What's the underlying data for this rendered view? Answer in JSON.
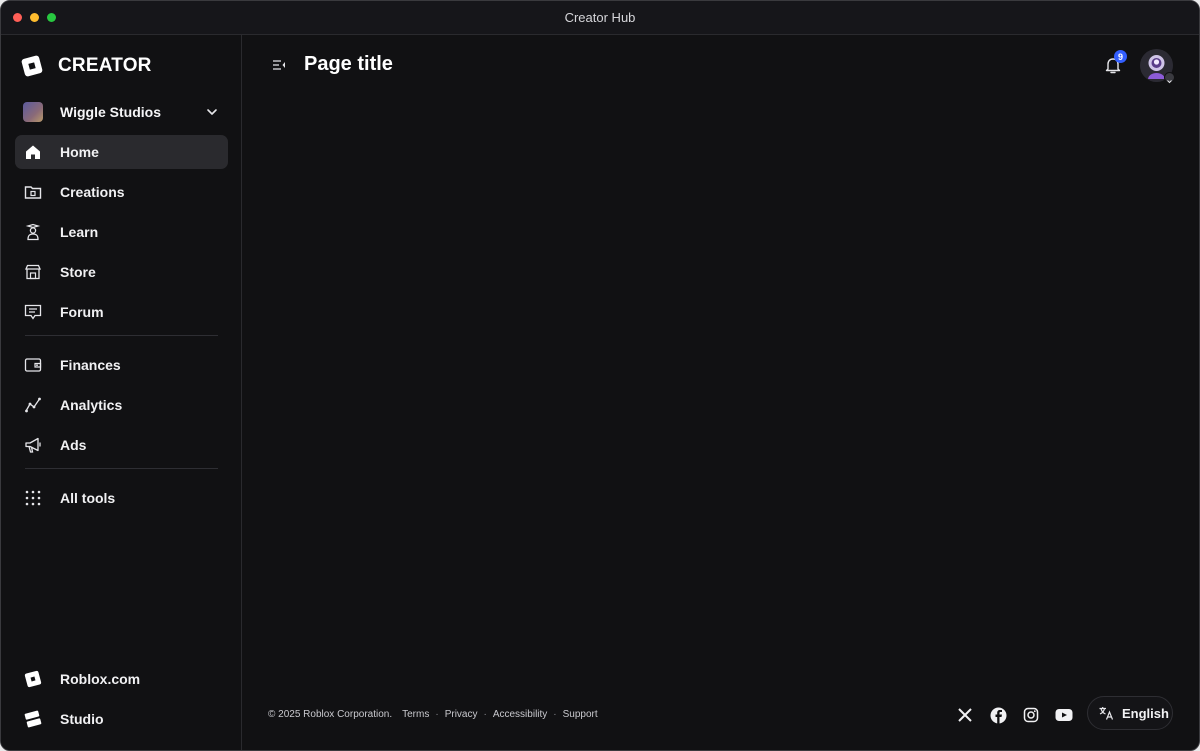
{
  "window": {
    "title": "Creator Hub"
  },
  "brand": {
    "name": "CREATOR"
  },
  "workspace": {
    "name": "Wiggle Studios"
  },
  "nav": {
    "primary": [
      {
        "label": "Home",
        "icon": "home-icon",
        "active": true
      },
      {
        "label": "Creations",
        "icon": "folder-icon"
      },
      {
        "label": "Learn",
        "icon": "learn-icon"
      },
      {
        "label": "Store",
        "icon": "store-icon"
      },
      {
        "label": "Forum",
        "icon": "forum-icon"
      }
    ],
    "secondary": [
      {
        "label": "Finances",
        "icon": "wallet-icon"
      },
      {
        "label": "Analytics",
        "icon": "analytics-icon"
      },
      {
        "label": "Ads",
        "icon": "megaphone-icon"
      }
    ],
    "tools": {
      "label": "All tools",
      "icon": "grid-icon"
    },
    "bottom": [
      {
        "label": "Roblox.com",
        "icon": "roblox-logo-icon"
      },
      {
        "label": "Studio",
        "icon": "studio-logo-icon"
      }
    ]
  },
  "header": {
    "page_title": "Page title",
    "notification_count": "9"
  },
  "footer": {
    "copyright": "© 2025 Roblox Corporation.",
    "links": [
      "Terms",
      "Privacy",
      "Accessibility",
      "Support"
    ],
    "language": "English"
  },
  "colors": {
    "accent": "#335fff",
    "background": "#111113",
    "sidebar_active": "#2a2a2e"
  }
}
